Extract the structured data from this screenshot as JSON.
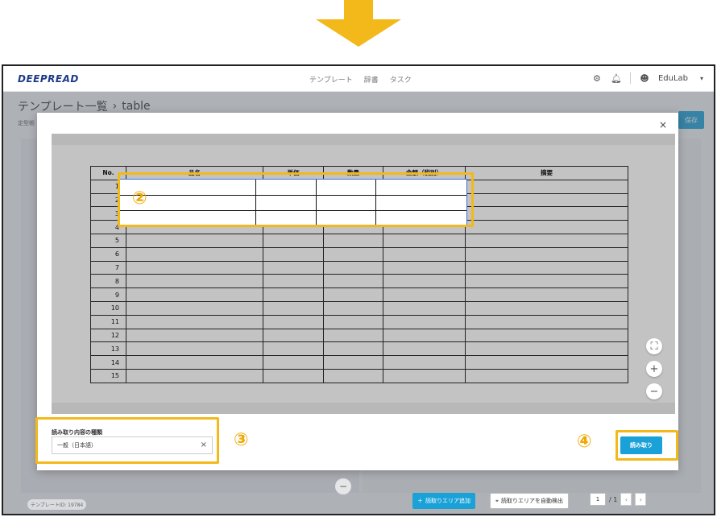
{
  "header": {
    "logo": "DEEPREAD",
    "nav": [
      "テンプレート",
      "辞書",
      "タスク"
    ],
    "user_name": "EduLab",
    "icons": [
      "gear-icon",
      "bell-icon",
      "user-icon",
      "chevron-down-icon"
    ]
  },
  "page": {
    "title": "テンプレート一覧",
    "breadcrumb_sep": "›",
    "current": "table",
    "sub": "定型帳",
    "save_label": "保存"
  },
  "bottom": {
    "template_id": "テンプレートID: 19784",
    "add_area_label": "読取りエリア追加",
    "auto_detect_label": "読取りエリアを自動検出",
    "page_current": "1",
    "page_total": "/ 1"
  },
  "modal": {
    "close": "×",
    "field_label": "読み取り内容の種類",
    "field_value": "一般（日本語）",
    "field_clear": "×",
    "read_button": "読み取り",
    "table": {
      "headers": [
        "No.",
        "品名",
        "単価",
        "数量",
        "金額（税別）",
        "摘要"
      ],
      "rows": [
        "1",
        "2",
        "3",
        "4",
        "5",
        "6",
        "7",
        "8",
        "9",
        "10",
        "11",
        "12",
        "13",
        "14",
        "15"
      ]
    },
    "controls": [
      "fullscreen-icon",
      "zoom-in-icon",
      "zoom-out-icon"
    ]
  },
  "annotations": {
    "two": "②",
    "three": "③",
    "four": "④",
    "accent": "#f3b81a"
  }
}
